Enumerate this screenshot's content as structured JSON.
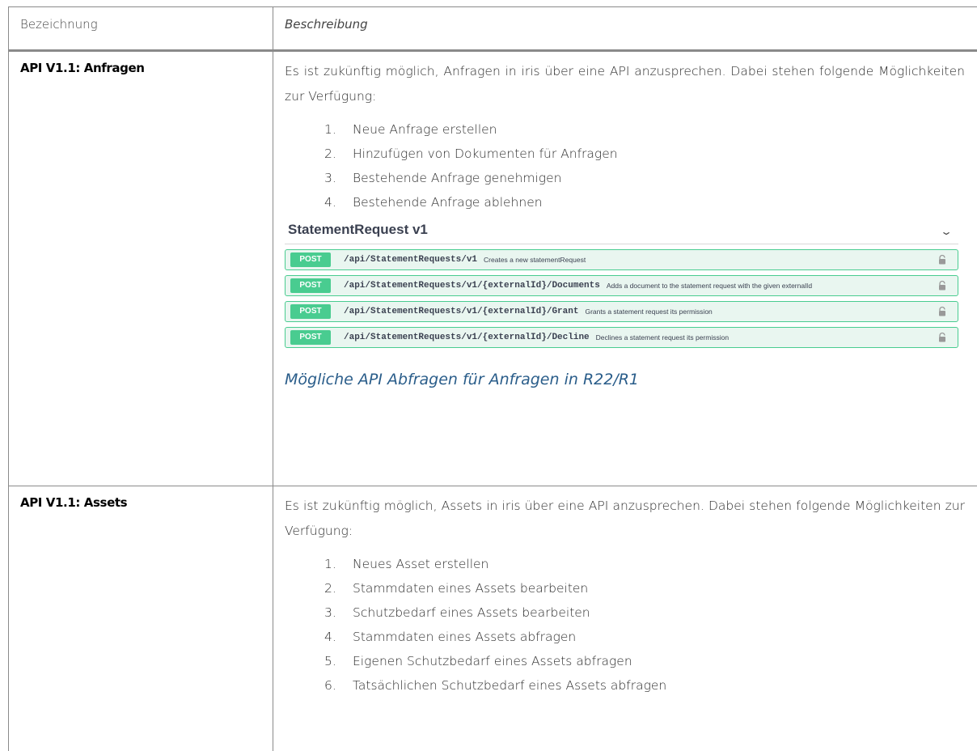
{
  "header": {
    "col1": "Bezeichnung",
    "col2": "Beschreibung"
  },
  "rows": [
    {
      "label": "API V1.1: Anfragen",
      "description": "Es ist zukünftig möglich, Anfragen in iris über eine API anzusprechen. Dabei stehen folgende Möglichkeiten zur Verfügung:",
      "steps": [
        {
          "num": "1.",
          "text": "Neue Anfrage erstellen"
        },
        {
          "num": "2.",
          "text": "Hinzufügen von Dokumenten für Anfragen"
        },
        {
          "num": "3.",
          "text": "Bestehende Anfrage genehmigen"
        },
        {
          "num": "4.",
          "text": "Bestehende Anfrage ablehnen"
        }
      ],
      "swagger": {
        "title": "StatementRequest v1",
        "chevron_icon": "chevron-down-icon",
        "operations": [
          {
            "method": "POST",
            "path": "/api/StatementRequests/v1",
            "summary": "Creates a new statementRequest"
          },
          {
            "method": "POST",
            "path": "/api/StatementRequests/v1/{externalId}/Documents",
            "summary": "Adds a document to the statement request with the given externalId"
          },
          {
            "method": "POST",
            "path": "/api/StatementRequests/v1/{externalId}/Grant",
            "summary": "Grants a statement request its permission"
          },
          {
            "method": "POST",
            "path": "/api/StatementRequests/v1/{externalId}/Decline",
            "summary": "Declines a statement request its permission"
          }
        ],
        "accent_color": "#49cc90"
      },
      "caption": "Mögliche API Abfragen für Anfragen in R22/R1"
    },
    {
      "label": "API V1.1: Assets",
      "description": "Es ist zukünftig möglich, Assets in iris über eine API anzusprechen. Dabei stehen folgende Möglichkeiten zur Verfügung:",
      "steps": [
        {
          "num": "1.",
          "text": "Neues Asset erstellen"
        },
        {
          "num": "2.",
          "text": "Stammdaten eines Assets bearbeiten"
        },
        {
          "num": "3.",
          "text": "Schutzbedarf eines Assets bearbeiten"
        },
        {
          "num": "4.",
          "text": "Stammdaten eines Assets abfragen"
        },
        {
          "num": "5.",
          "text": "Eigenen Schutzbedarf eines Assets abfragen"
        },
        {
          "num": "6.",
          "text": "Tatsächlichen Schutzbedarf eines Assets abfragen"
        }
      ]
    }
  ]
}
